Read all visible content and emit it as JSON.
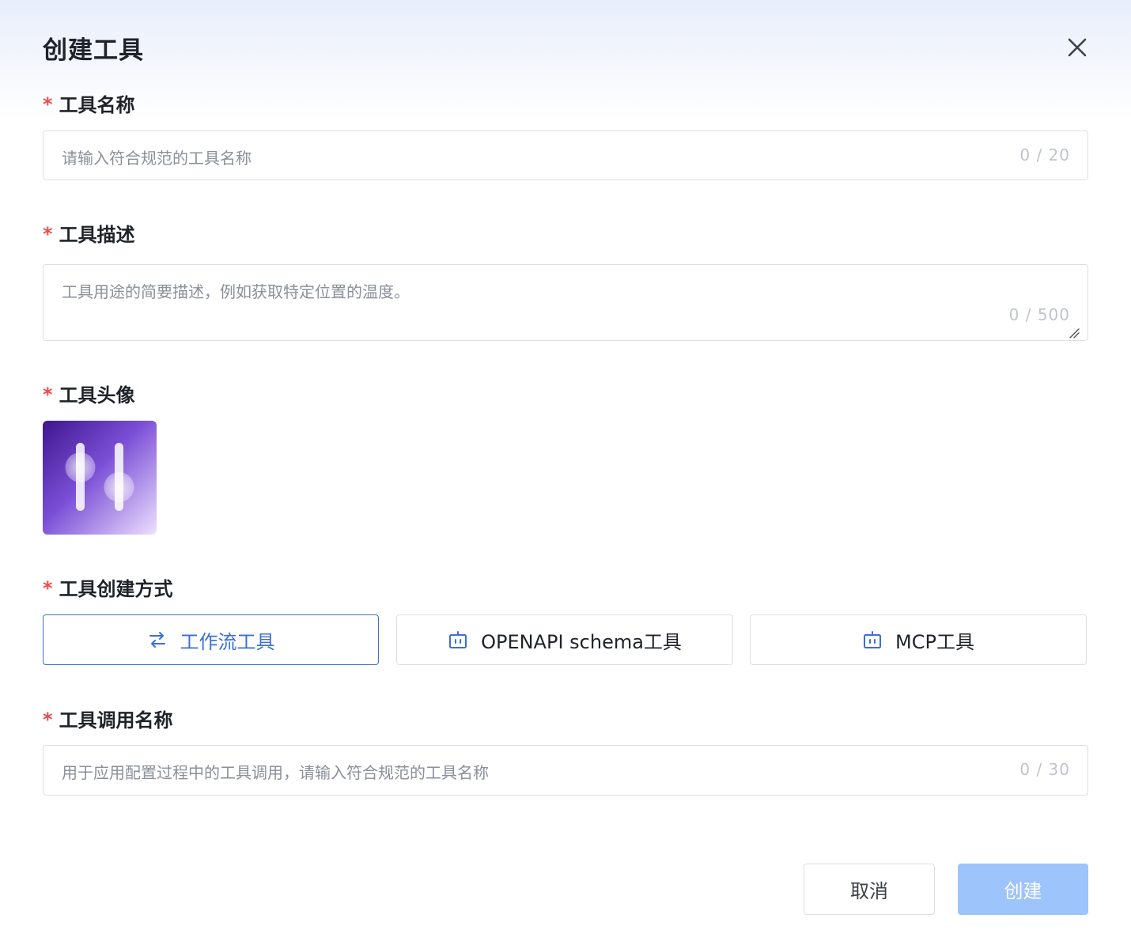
{
  "dialog": {
    "title": "创建工具",
    "close_icon": "close-icon"
  },
  "fields": {
    "name": {
      "required_mark": "*",
      "label": "工具名称",
      "placeholder": "请输入符合规范的工具名称",
      "value": "",
      "counter": "0 / 20"
    },
    "description": {
      "required_mark": "*",
      "label": "工具描述",
      "placeholder": "工具用途的简要描述，例如获取特定位置的温度。",
      "value": "",
      "counter": "0 / 500"
    },
    "avatar": {
      "required_mark": "*",
      "label": "工具头像",
      "icon": "slider-controls-icon"
    },
    "creation_mode": {
      "required_mark": "*",
      "label": "工具创建方式",
      "options": [
        {
          "label": "工作流工具",
          "icon": "swap-arrows-icon",
          "selected": true
        },
        {
          "label": "OPENAPI schema工具",
          "icon": "robot-icon",
          "selected": false
        },
        {
          "label": "MCP工具",
          "icon": "robot-icon",
          "selected": false
        }
      ]
    },
    "call_name": {
      "required_mark": "*",
      "label": "工具调用名称",
      "placeholder": "用于应用配置过程中的工具调用，请输入符合规范的工具名称",
      "value": "",
      "counter": "0 / 30"
    }
  },
  "footer": {
    "cancel_label": "取消",
    "create_label": "创建"
  },
  "colors": {
    "accent": "#3b6fd8",
    "required": "#f04a4a",
    "create_disabled": "#9dc4fb",
    "avatar_gradient": [
      "#4a1f9e",
      "#e6d6ff"
    ]
  }
}
